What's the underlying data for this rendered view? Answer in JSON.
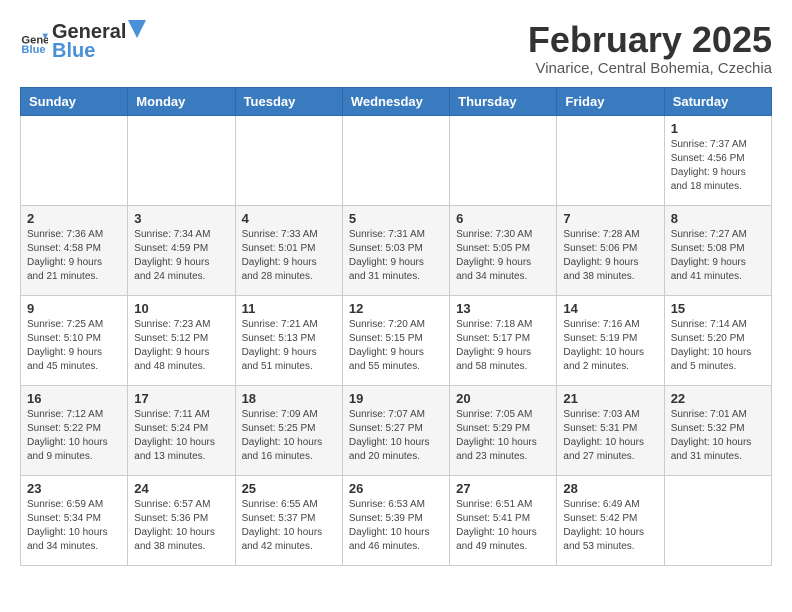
{
  "header": {
    "logo_general": "General",
    "logo_blue": "Blue",
    "month": "February 2025",
    "location": "Vinarice, Central Bohemia, Czechia"
  },
  "weekdays": [
    "Sunday",
    "Monday",
    "Tuesday",
    "Wednesday",
    "Thursday",
    "Friday",
    "Saturday"
  ],
  "weeks": [
    [
      {
        "day": "",
        "info": ""
      },
      {
        "day": "",
        "info": ""
      },
      {
        "day": "",
        "info": ""
      },
      {
        "day": "",
        "info": ""
      },
      {
        "day": "",
        "info": ""
      },
      {
        "day": "",
        "info": ""
      },
      {
        "day": "1",
        "info": "Sunrise: 7:37 AM\nSunset: 4:56 PM\nDaylight: 9 hours\nand 18 minutes."
      }
    ],
    [
      {
        "day": "2",
        "info": "Sunrise: 7:36 AM\nSunset: 4:58 PM\nDaylight: 9 hours\nand 21 minutes."
      },
      {
        "day": "3",
        "info": "Sunrise: 7:34 AM\nSunset: 4:59 PM\nDaylight: 9 hours\nand 24 minutes."
      },
      {
        "day": "4",
        "info": "Sunrise: 7:33 AM\nSunset: 5:01 PM\nDaylight: 9 hours\nand 28 minutes."
      },
      {
        "day": "5",
        "info": "Sunrise: 7:31 AM\nSunset: 5:03 PM\nDaylight: 9 hours\nand 31 minutes."
      },
      {
        "day": "6",
        "info": "Sunrise: 7:30 AM\nSunset: 5:05 PM\nDaylight: 9 hours\nand 34 minutes."
      },
      {
        "day": "7",
        "info": "Sunrise: 7:28 AM\nSunset: 5:06 PM\nDaylight: 9 hours\nand 38 minutes."
      },
      {
        "day": "8",
        "info": "Sunrise: 7:27 AM\nSunset: 5:08 PM\nDaylight: 9 hours\nand 41 minutes."
      }
    ],
    [
      {
        "day": "9",
        "info": "Sunrise: 7:25 AM\nSunset: 5:10 PM\nDaylight: 9 hours\nand 45 minutes."
      },
      {
        "day": "10",
        "info": "Sunrise: 7:23 AM\nSunset: 5:12 PM\nDaylight: 9 hours\nand 48 minutes."
      },
      {
        "day": "11",
        "info": "Sunrise: 7:21 AM\nSunset: 5:13 PM\nDaylight: 9 hours\nand 51 minutes."
      },
      {
        "day": "12",
        "info": "Sunrise: 7:20 AM\nSunset: 5:15 PM\nDaylight: 9 hours\nand 55 minutes."
      },
      {
        "day": "13",
        "info": "Sunrise: 7:18 AM\nSunset: 5:17 PM\nDaylight: 9 hours\nand 58 minutes."
      },
      {
        "day": "14",
        "info": "Sunrise: 7:16 AM\nSunset: 5:19 PM\nDaylight: 10 hours\nand 2 minutes."
      },
      {
        "day": "15",
        "info": "Sunrise: 7:14 AM\nSunset: 5:20 PM\nDaylight: 10 hours\nand 5 minutes."
      }
    ],
    [
      {
        "day": "16",
        "info": "Sunrise: 7:12 AM\nSunset: 5:22 PM\nDaylight: 10 hours\nand 9 minutes."
      },
      {
        "day": "17",
        "info": "Sunrise: 7:11 AM\nSunset: 5:24 PM\nDaylight: 10 hours\nand 13 minutes."
      },
      {
        "day": "18",
        "info": "Sunrise: 7:09 AM\nSunset: 5:25 PM\nDaylight: 10 hours\nand 16 minutes."
      },
      {
        "day": "19",
        "info": "Sunrise: 7:07 AM\nSunset: 5:27 PM\nDaylight: 10 hours\nand 20 minutes."
      },
      {
        "day": "20",
        "info": "Sunrise: 7:05 AM\nSunset: 5:29 PM\nDaylight: 10 hours\nand 23 minutes."
      },
      {
        "day": "21",
        "info": "Sunrise: 7:03 AM\nSunset: 5:31 PM\nDaylight: 10 hours\nand 27 minutes."
      },
      {
        "day": "22",
        "info": "Sunrise: 7:01 AM\nSunset: 5:32 PM\nDaylight: 10 hours\nand 31 minutes."
      }
    ],
    [
      {
        "day": "23",
        "info": "Sunrise: 6:59 AM\nSunset: 5:34 PM\nDaylight: 10 hours\nand 34 minutes."
      },
      {
        "day": "24",
        "info": "Sunrise: 6:57 AM\nSunset: 5:36 PM\nDaylight: 10 hours\nand 38 minutes."
      },
      {
        "day": "25",
        "info": "Sunrise: 6:55 AM\nSunset: 5:37 PM\nDaylight: 10 hours\nand 42 minutes."
      },
      {
        "day": "26",
        "info": "Sunrise: 6:53 AM\nSunset: 5:39 PM\nDaylight: 10 hours\nand 46 minutes."
      },
      {
        "day": "27",
        "info": "Sunrise: 6:51 AM\nSunset: 5:41 PM\nDaylight: 10 hours\nand 49 minutes."
      },
      {
        "day": "28",
        "info": "Sunrise: 6:49 AM\nSunset: 5:42 PM\nDaylight: 10 hours\nand 53 minutes."
      },
      {
        "day": "",
        "info": ""
      }
    ]
  ]
}
